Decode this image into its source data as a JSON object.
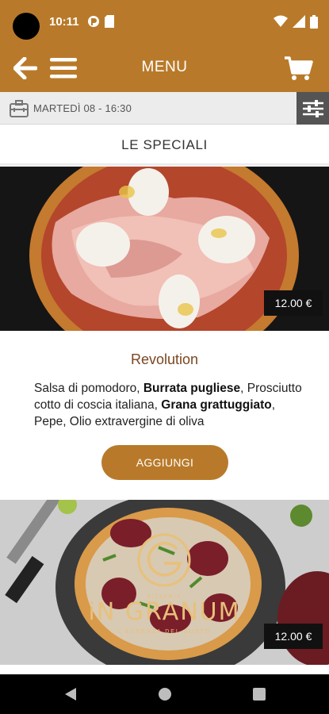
{
  "status_bar": {
    "time": "10:11"
  },
  "header": {
    "title": "MENU"
  },
  "slot": {
    "text": "MARTEDÌ 08 - 16:30"
  },
  "section": {
    "title": "LE SPECIALI"
  },
  "products": [
    {
      "name": "Revolution",
      "price": "12.00 €",
      "desc_parts": [
        {
          "text": "Salsa di pomodoro, ",
          "bold": false
        },
        {
          "text": "Burrata pugliese",
          "bold": true
        },
        {
          "text": ", Prosciutto cotto di coscia italiana, ",
          "bold": false
        },
        {
          "text": "Grana grattuggiato",
          "bold": true
        },
        {
          "text": ", Pepe, Olio extravergine di oliva",
          "bold": false
        }
      ],
      "add_label": "AGGIUNGI"
    },
    {
      "price": "12.00 €",
      "logo_name": "iN GRANUM",
      "logo_small": "PIZZERIA",
      "logo_sub": "L'ESSENZA DEL GUSTO"
    }
  ],
  "colors": {
    "brand": "#b87a2a",
    "slot_bg": "#ececec",
    "filter_bg": "#545454",
    "product_name": "#7a4620",
    "price_bg": "#111111"
  },
  "icons": {
    "back": "arrow-left-icon",
    "menu": "hamburger-icon",
    "cart": "cart-icon",
    "slot": "briefcase-icon",
    "filter": "sliders-icon"
  }
}
